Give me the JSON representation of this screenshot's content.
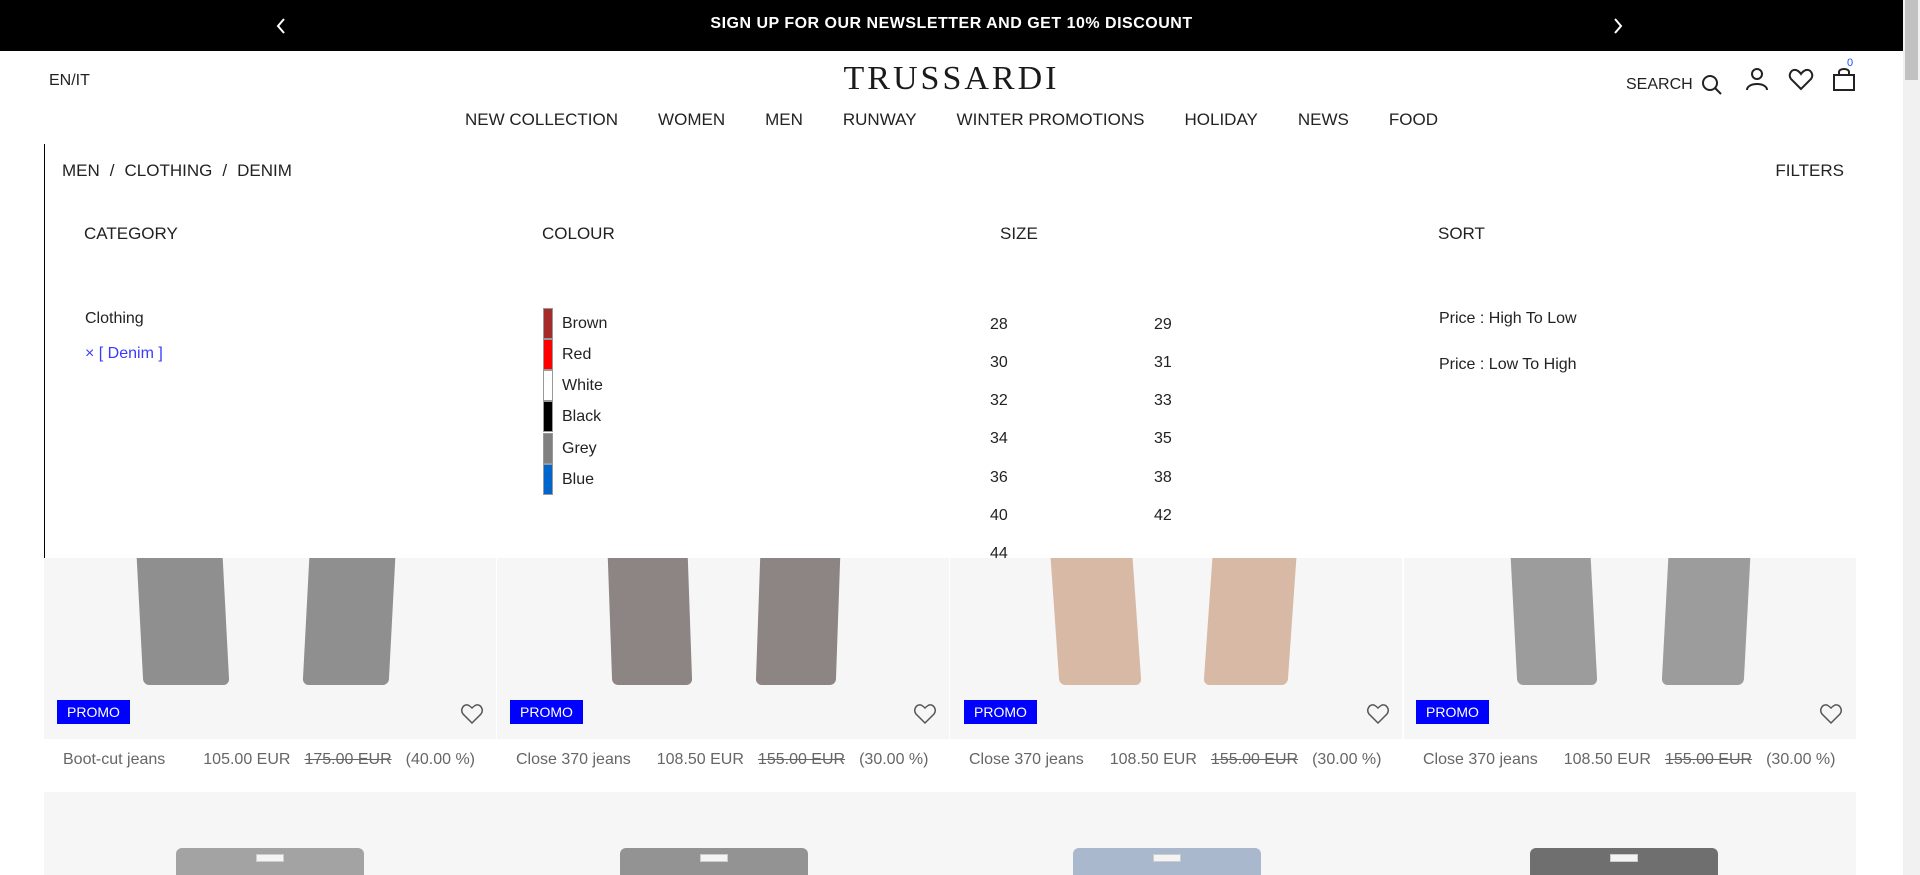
{
  "banner": {
    "text": "SIGN UP FOR OUR NEWSLETTER AND GET 10% DISCOUNT"
  },
  "header": {
    "lang": "EN/IT",
    "logo": "TRUSSARDI",
    "search_label": "SEARCH",
    "cart_count": "0"
  },
  "nav": {
    "items": [
      "NEW COLLECTION",
      "WOMEN",
      "MEN",
      "RUNWAY",
      "WINTER PROMOTIONS",
      "HOLIDAY",
      "NEWS",
      "FOOD"
    ]
  },
  "filters": {
    "breadcrumb": [
      "MEN",
      "/",
      "CLOTHING",
      "/",
      "DENIM"
    ],
    "filters_label": "FILTERS",
    "category_title": "CATEGORY",
    "colour_title": "COLOUR",
    "size_title": "SIZE",
    "sort_title": "SORT",
    "category_items": [
      "Clothing",
      "× [ Denim ]"
    ],
    "colours": [
      {
        "name": "Brown",
        "color": "#a52a2a"
      },
      {
        "name": "Red",
        "color": "#ff0000"
      },
      {
        "name": "White",
        "color": "#ffffff"
      },
      {
        "name": "Black",
        "color": "#000000"
      },
      {
        "name": "Grey",
        "color": "#808080"
      },
      {
        "name": "Blue",
        "color": "#0066cc"
      }
    ],
    "sizes": [
      "28",
      "29",
      "30",
      "31",
      "32",
      "33",
      "34",
      "35",
      "36",
      "38",
      "40",
      "42",
      "44"
    ],
    "sort_options": [
      "Price : High To Low",
      "Price : Low To High"
    ]
  },
  "products": [
    {
      "name": "Boot-cut jeans",
      "price": "105.00 EUR",
      "old_price": "175.00 EUR",
      "discount": "(40.00 %)",
      "badge": "PROMO",
      "color": "#8f8f8f"
    },
    {
      "name": "Close 370 jeans",
      "price": "108.50 EUR",
      "old_price": "155.00 EUR",
      "discount": "(30.00 %)",
      "badge": "PROMO",
      "color": "#8c8584"
    },
    {
      "name": "Close 370 jeans",
      "price": "108.50 EUR",
      "old_price": "155.00 EUR",
      "discount": "(30.00 %)",
      "badge": "PROMO",
      "color": "#d8b9a6"
    },
    {
      "name": "Close 370 jeans",
      "price": "108.50 EUR",
      "old_price": "155.00 EUR",
      "discount": "(30.00 %)",
      "badge": "PROMO",
      "color": "#9c9c9c"
    }
  ],
  "row2_colors": [
    "#a3a3a3",
    "#939393",
    "#a9b8cc",
    "#6f6f6f"
  ]
}
